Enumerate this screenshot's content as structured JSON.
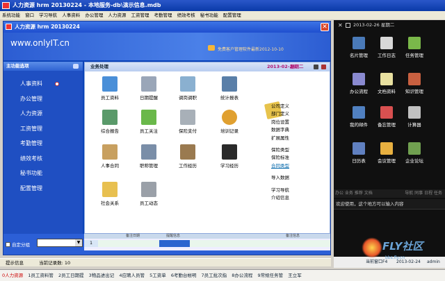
{
  "app": {
    "title": "人力资源 hrm 20130224 - 本地服务-db\\演示信息.mdb"
  },
  "menu": [
    "系统功能",
    "窗口",
    "学习导航",
    "人事资料",
    "办公管理",
    "人力资源",
    "工资管理",
    "考勤管理",
    "绩效考核",
    "秘书功能",
    "配置管理"
  ],
  "inner": {
    "title": "人力资源 hrm 20130224",
    "close": "✕"
  },
  "banner": {
    "site": "www.onlyIT.cn",
    "notice": "免费客户管理软件最新2012-10-10"
  },
  "sidebar": {
    "header": "主功能选项",
    "items": [
      "人事资料",
      "办公管理",
      "人力资源",
      "工资管理",
      "考勤管理",
      "绩效考核",
      "秘书功能",
      "配置管理"
    ]
  },
  "main": {
    "header": "业务处理",
    "date": "2013-02-26",
    "weekday": "星期二",
    "tiles": [
      {
        "label": "员工资料",
        "icon": "document-edit-icon",
        "color": "#4a8fd8"
      },
      {
        "label": "日期提醒",
        "icon": "magnifier-calendar-icon",
        "color": "#9aa6b8"
      },
      {
        "label": "调岗调职",
        "icon": "magnifier-icon",
        "color": "#8ab0d0"
      },
      {
        "label": "统计报表",
        "icon": "report-icon",
        "color": "#5a7fa8"
      },
      {
        "label": "综合报告",
        "icon": "chart-icon",
        "color": "#5a9a6a"
      },
      {
        "label": "员工关注",
        "icon": "plant-icon",
        "color": "#6ab84a"
      },
      {
        "label": "保险支付",
        "icon": "magnifier-money-icon",
        "color": "#a8b0b8"
      },
      {
        "label": "培训记录",
        "icon": "clock-icon",
        "color": "#e0a030"
      },
      {
        "label": "人事合同",
        "icon": "handshake-icon",
        "color": "#c8a060"
      },
      {
        "label": "职称管理",
        "icon": "monitor-icon",
        "color": "#7a8ea8"
      },
      {
        "label": "工作经历",
        "icon": "briefcase-icon",
        "color": "#9a7a50"
      },
      {
        "label": "学习经历",
        "icon": "graduation-icon",
        "color": "#2a2a2a"
      },
      {
        "label": "社会关系",
        "icon": "folder-icon",
        "color": "#e8c050"
      },
      {
        "label": "员工动态",
        "icon": "megaphone-icon",
        "color": "#9aa0a8"
      }
    ],
    "links_a": [
      "公司定义",
      "部门定义",
      "岗位设置",
      "数据字典",
      "扩展属性"
    ],
    "links_b": [
      "保险类型",
      "保险标准",
      "合同类型"
    ],
    "links_c": [
      "导入数据"
    ],
    "links_d": [
      "学习导航",
      "介绍信息"
    ]
  },
  "bottom": {
    "group_label": "自定分组",
    "col1": "备注日期",
    "col2": "提醒信息",
    "col3": "备注信息",
    "row_no": "1"
  },
  "status": {
    "hint": "提示信息",
    "records": "当前记录数: 10"
  },
  "taskbar": [
    "0人力资源",
    "1员工资料管",
    "2员工日期提",
    "3物品进出记",
    "4应聘人员管",
    "5工资单",
    "6考勤台帐明",
    "7员工批次指",
    "8办公流程",
    "9常规任务管",
    "王立军"
  ],
  "right": {
    "date": "2013-02-26",
    "weekday": "星期二",
    "tiles": [
      {
        "label": "名片管理",
        "icon": "business-card-icon",
        "color": "#4a7ab8"
      },
      {
        "label": "工作日志",
        "icon": "notebook-icon",
        "color": "#d8d8d8"
      },
      {
        "label": "任务管理",
        "icon": "task-icon",
        "color": "#7ab84a"
      },
      {
        "label": "办公流程",
        "icon": "workflow-icon",
        "color": "#8a8ad0"
      },
      {
        "label": "文档资料",
        "icon": "document-icon",
        "color": "#e8e0a0"
      },
      {
        "label": "知识管理",
        "icon": "knowledge-icon",
        "color": "#c86040"
      },
      {
        "label": "我的邮件",
        "icon": "mail-icon",
        "color": "#5080c0"
      },
      {
        "label": "备忘管理",
        "icon": "memo-icon",
        "color": "#d85050"
      },
      {
        "label": "计算器",
        "icon": "calculator-icon",
        "color": "#c0c0c0"
      },
      {
        "label": "日历表",
        "icon": "calendar-clock-icon",
        "color": "#6080c0"
      },
      {
        "label": "会议管理",
        "icon": "meeting-icon",
        "color": "#e8b040"
      },
      {
        "label": "企业论坛",
        "icon": "forum-icon",
        "color": "#70a050"
      }
    ],
    "tabs_left": "办公  业务  推荐  文档",
    "tabs_right": "导航  同事  日程  任务",
    "message": "欢迎使用，这个地方可以输入内容",
    "footer_left": "当前窗口F4",
    "footer_date": "2013-02-24",
    "footer_user": "admin"
  },
  "watermark": {
    "brand": "FLY社区",
    "url": "bbs.fly.cn"
  }
}
